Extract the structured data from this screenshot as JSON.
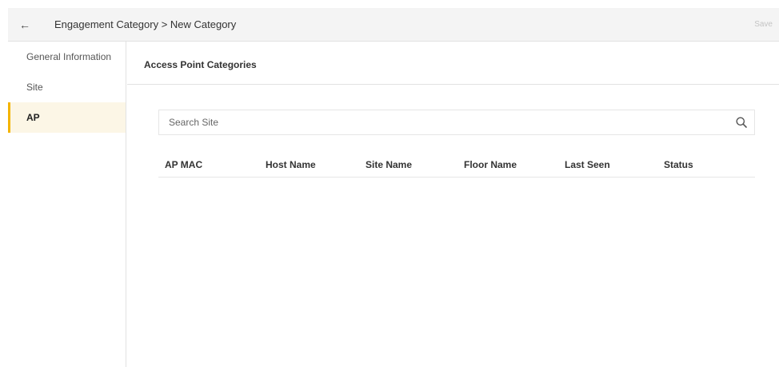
{
  "header": {
    "back_icon": "back-arrow-icon",
    "breadcrumb": "Engagement Category > New Category",
    "save_label": "Save"
  },
  "sidebar": {
    "items": [
      {
        "label": "General Information",
        "active": false
      },
      {
        "label": "Site",
        "active": false
      },
      {
        "label": "AP",
        "active": true
      }
    ]
  },
  "main": {
    "title": "Access Point Categories",
    "search": {
      "placeholder": "Search Site",
      "value": ""
    },
    "table": {
      "columns": [
        "AP MAC",
        "Host Name",
        "Site Name",
        "Floor Name",
        "Last Seen",
        "Status"
      ],
      "rows": []
    }
  },
  "colors": {
    "accent": "#f4b400",
    "active_bg": "#fcf6e6",
    "topbar_bg": "#f4f4f4"
  }
}
